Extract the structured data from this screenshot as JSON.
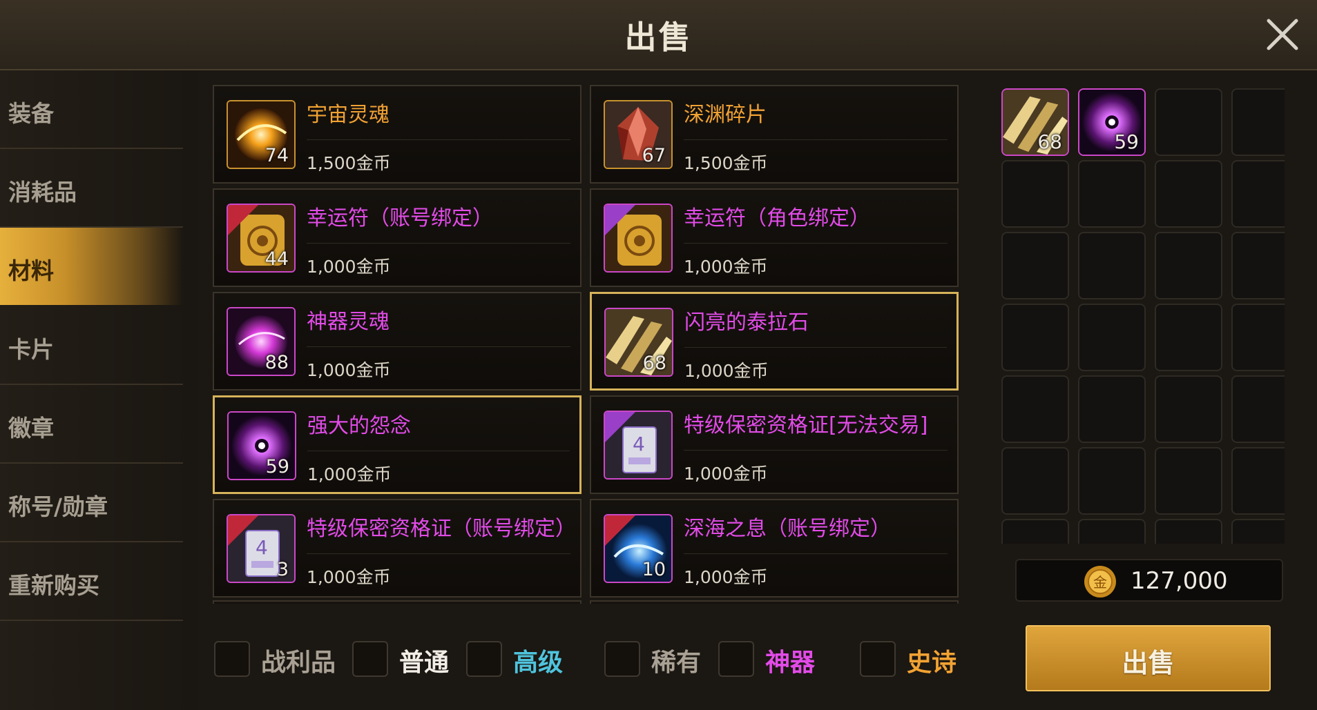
{
  "header": {
    "title": "出售"
  },
  "sidebar": {
    "items": [
      {
        "label": "装备"
      },
      {
        "label": "消耗品"
      },
      {
        "label": "材料"
      },
      {
        "label": "卡片"
      },
      {
        "label": "徽章"
      },
      {
        "label": "称号/勋章"
      },
      {
        "label": "重新购买"
      }
    ],
    "active": "材料"
  },
  "items": [
    {
      "name": "宇宙灵魂",
      "price": "1,500金币",
      "count": "74",
      "name_color": "#f2a233",
      "icon": "cosmic-soul-icon"
    },
    {
      "name": "深渊碎片",
      "price": "1,500金币",
      "count": "67",
      "name_color": "#f2a233",
      "icon": "abyss-fragment-icon"
    },
    {
      "name": "幸运符（账号绑定）",
      "price": "1,000金币",
      "count": "44",
      "name_color": "#e24be8",
      "icon": "lucky-charm-icon",
      "tag": "账号"
    },
    {
      "name": "幸运符（角色绑定）",
      "price": "1,000金币",
      "count": "",
      "name_color": "#e24be8",
      "icon": "lucky-charm-icon",
      "tag": "角色"
    },
    {
      "name": "神器灵魂",
      "price": "1,000金币",
      "count": "88",
      "name_color": "#e24be8",
      "icon": "artifact-soul-icon"
    },
    {
      "name": "闪亮的泰拉石",
      "price": "1,000金币",
      "count": "68",
      "name_color": "#e24be8",
      "icon": "terra-stone-icon"
    },
    {
      "name": "强大的怨念",
      "price": "1,000金币",
      "count": "59",
      "name_color": "#e24be8",
      "icon": "strong-grudge-icon"
    },
    {
      "name": "特级保密资格证[无法交易]",
      "price": "1,000金币",
      "count": "",
      "name_color": "#e24be8",
      "icon": "clearance-card-icon",
      "tag": "绑定"
    },
    {
      "name": "特级保密资格证（账号绑定）",
      "price": "1,000金币",
      "count": "3",
      "name_color": "#e24be8",
      "icon": "clearance-card-icon",
      "tag": "账号"
    },
    {
      "name": "深海之息（账号绑定）",
      "price": "1,000金币",
      "count": "10",
      "name_color": "#e24be8",
      "icon": "deep-sea-breath-icon",
      "tag": "账号"
    }
  ],
  "filters": [
    {
      "label": "战利品",
      "color": "#a9a194"
    },
    {
      "label": "普通",
      "color": "#f2eee6"
    },
    {
      "label": "高级",
      "color": "#4fc3dd"
    },
    {
      "label": "稀有",
      "color": "#a9a194"
    },
    {
      "label": "神器",
      "color": "#e24be8"
    },
    {
      "label": "史诗",
      "color": "#f2a233"
    }
  ],
  "sell_slots": [
    {
      "count": "68",
      "icon": "terra-stone-icon"
    },
    {
      "count": "59",
      "icon": "strong-grudge-icon"
    }
  ],
  "gold": {
    "value": "127,000",
    "icon_char": "金"
  },
  "sell_button": {
    "label": "出售"
  }
}
